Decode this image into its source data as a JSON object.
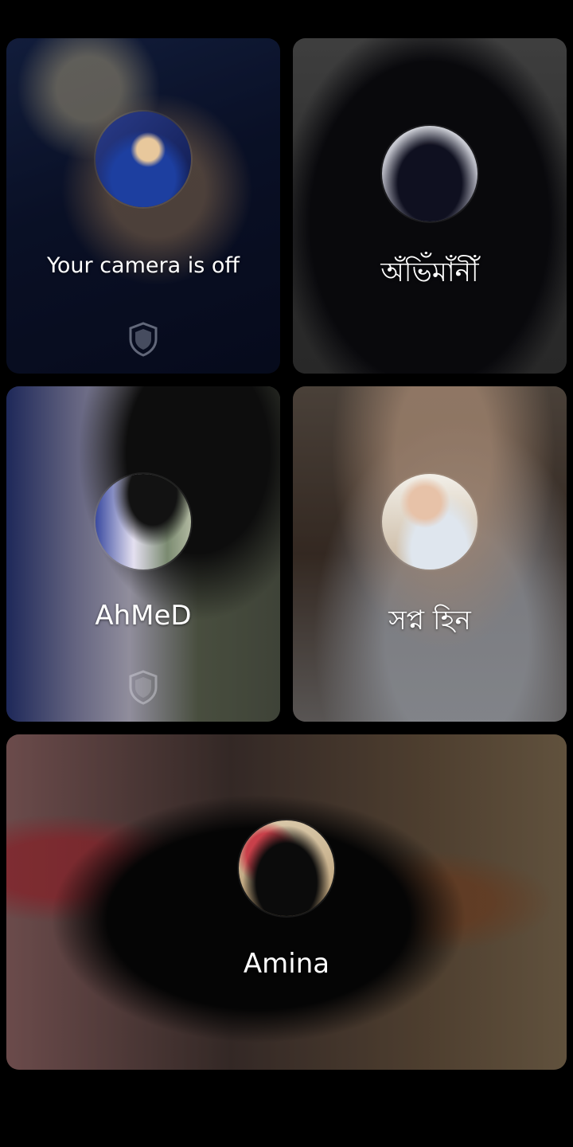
{
  "participants": [
    {
      "name": "Your camera is off",
      "is_self": true,
      "shows_shield": true
    },
    {
      "name": "অঁভিঁমাঁনীঁ",
      "is_self": false,
      "shows_shield": false
    },
    {
      "name": "AhMeD",
      "is_self": false,
      "shows_shield": true
    },
    {
      "name": "সপ্ন হিন",
      "is_self": false,
      "shows_shield": false
    },
    {
      "name": "Amina",
      "is_self": false,
      "shows_shield": false
    }
  ],
  "icons": {
    "shield": "shield-icon"
  },
  "colors": {
    "background": "#000000",
    "text": "#ffffff"
  }
}
